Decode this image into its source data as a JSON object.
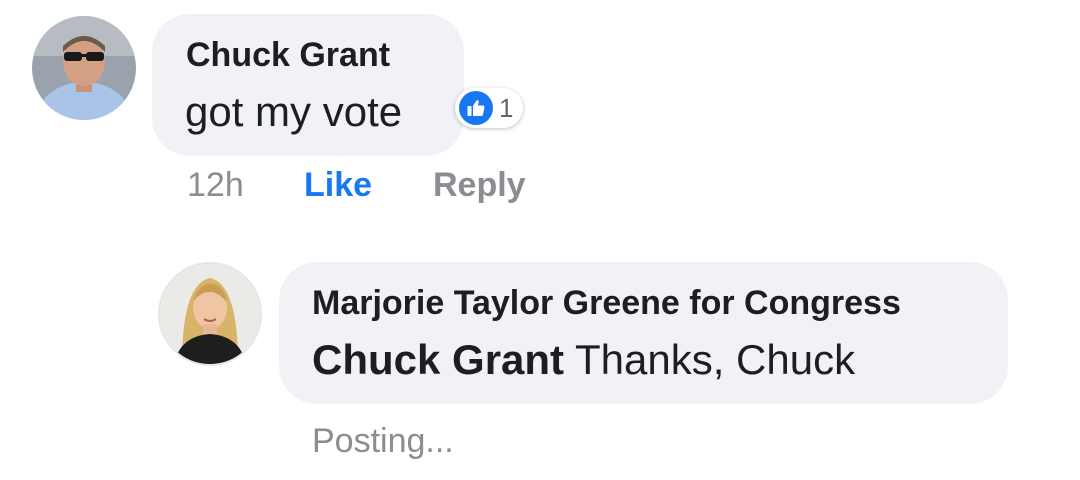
{
  "comment": {
    "author": "Chuck Grant",
    "text": "got my vote",
    "reaction": {
      "icon": "thumbs-up-icon",
      "count": "1",
      "color": "#1877f2"
    },
    "actions": {
      "time": "12h",
      "like": "Like",
      "reply": "Reply"
    }
  },
  "reply": {
    "author": "Marjorie Taylor Greene for Congress",
    "mention": "Chuck Grant",
    "text": " Thanks, Chuck",
    "status": "Posting..."
  },
  "colors": {
    "bubble": "#f0f2f5",
    "text": "#1c1e21",
    "meta": "#8a8d91",
    "link": "#1877f2"
  }
}
